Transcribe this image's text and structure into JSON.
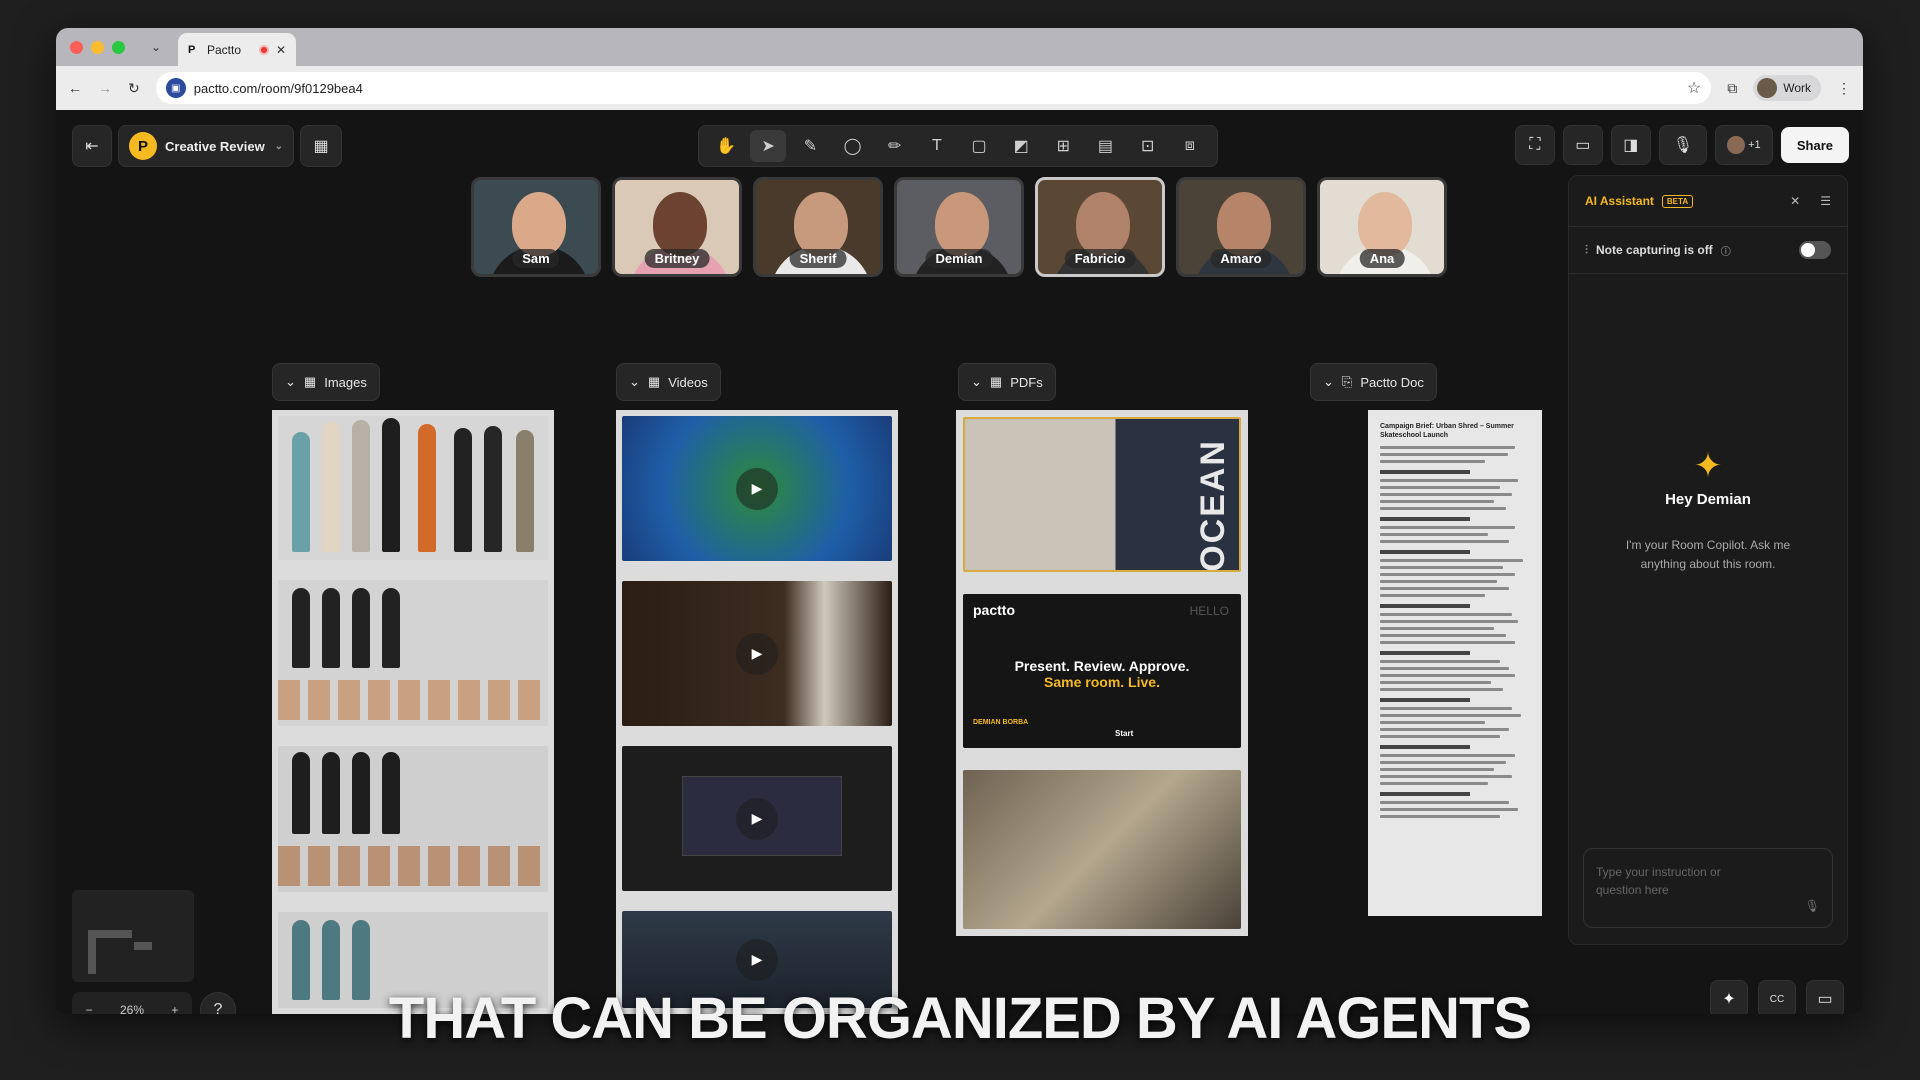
{
  "browser": {
    "tab_title": "Pactto",
    "url": "pactto.com/room/9f0129bea4",
    "profile_label": "Work"
  },
  "room": {
    "name": "Creative Review"
  },
  "toolbar": {
    "tools": [
      "hand-icon",
      "select-icon",
      "pen-icon",
      "lasso-icon",
      "pencil-icon",
      "text-icon",
      "shape-icon",
      "note-icon",
      "frame-icon",
      "table-icon",
      "embed-icon",
      "image-icon"
    ]
  },
  "controls": {
    "avatars_more": "+1",
    "share_label": "Share"
  },
  "participants": [
    {
      "name": "Sam",
      "bg": "#3c4a52",
      "skin": "#d9a98a",
      "shirt": "#1b1b1b"
    },
    {
      "name": "Britney",
      "bg": "#d9c9b6",
      "skin": "#6b4330",
      "shirt": "#e6a2b0"
    },
    {
      "name": "Sherif",
      "bg": "#4a3a2c",
      "skin": "#c79a7e",
      "shirt": "#e9e9e9"
    },
    {
      "name": "Demian",
      "bg": "#5b5d62",
      "skin": "#c9977a",
      "shirt": "#222"
    },
    {
      "name": "Fabricio",
      "bg": "#5a4734",
      "skin": "#b0826a",
      "shirt": "#333"
    },
    {
      "name": "Amaro",
      "bg": "#4b4238",
      "skin": "#b58469",
      "shirt": "#2e3640"
    },
    {
      "name": "Ana",
      "bg": "#e3dcd3",
      "skin": "#e2b99c",
      "shirt": "#f0efec"
    }
  ],
  "groups": {
    "images": "Images",
    "videos": "Videos",
    "pdfs": "PDFs",
    "doc": "Pactto Doc"
  },
  "pdf_cards": {
    "ocean_word": "OCEAN",
    "brand": "pactto",
    "headline": "Present. Review. Approve.",
    "subheadline": "Same room. Live.",
    "author": "DEMIAN BORBA",
    "start": "Start",
    "hello": "HELLO"
  },
  "doc": {
    "title": "Campaign Brief: Urban Shred – Summer Skateschool Launch"
  },
  "ai": {
    "title": "AI Assistant",
    "badge": "BETA",
    "note_capture": "Note capturing is off",
    "greeting": "Hey Demian",
    "subtitle": "I'm your Room Copilot. Ask me anything about this room.",
    "input_placeholder": "Type your instruction or question here"
  },
  "zoom": {
    "level": "26%"
  },
  "caption": "THAT CAN BE ORGANIZED BY AI AGENTS"
}
